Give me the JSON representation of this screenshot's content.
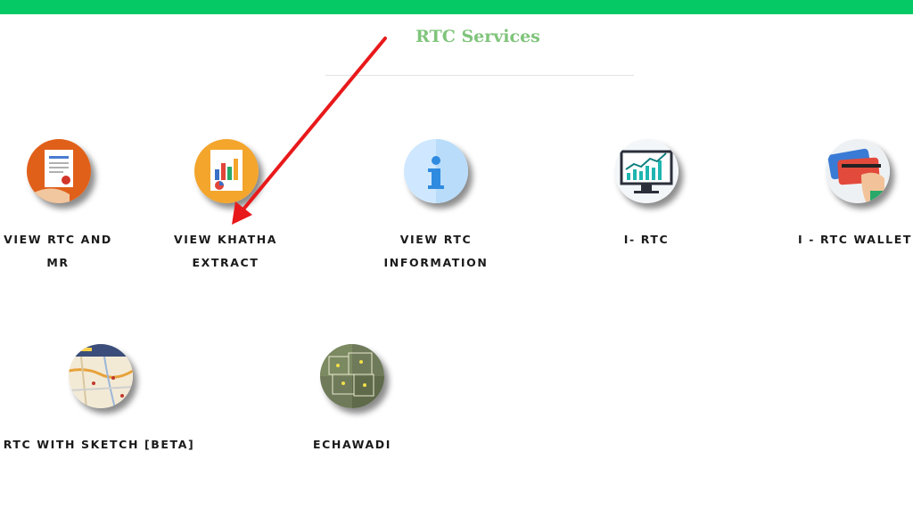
{
  "header": {
    "accent_color": "#04c964",
    "title": "RTC Services",
    "title_color": "#7fc47a"
  },
  "services": [
    {
      "icon": "document-certificate-icon",
      "line1": "VIEW RTC AND",
      "line2": "MR"
    },
    {
      "icon": "report-chart-icon",
      "line1": "VIEW KHATHA",
      "line2": "EXTRACT"
    },
    {
      "icon": "info-icon",
      "line1": "VIEW RTC",
      "line2": "INFORMATION"
    },
    {
      "icon": "monitor-chart-icon",
      "line1": "I- RTC",
      "line2": ""
    },
    {
      "icon": "wallet-cards-icon",
      "line1": "I - RTC WALLET",
      "line2": ""
    },
    {
      "icon": "map-icon",
      "line1": "RTC WITH SKETCH [BETA]",
      "line2": ""
    },
    {
      "icon": "satellite-map-icon",
      "line1": "ECHAWADI",
      "line2": ""
    }
  ],
  "annotation": {
    "arrow_color": "#e8191b"
  }
}
